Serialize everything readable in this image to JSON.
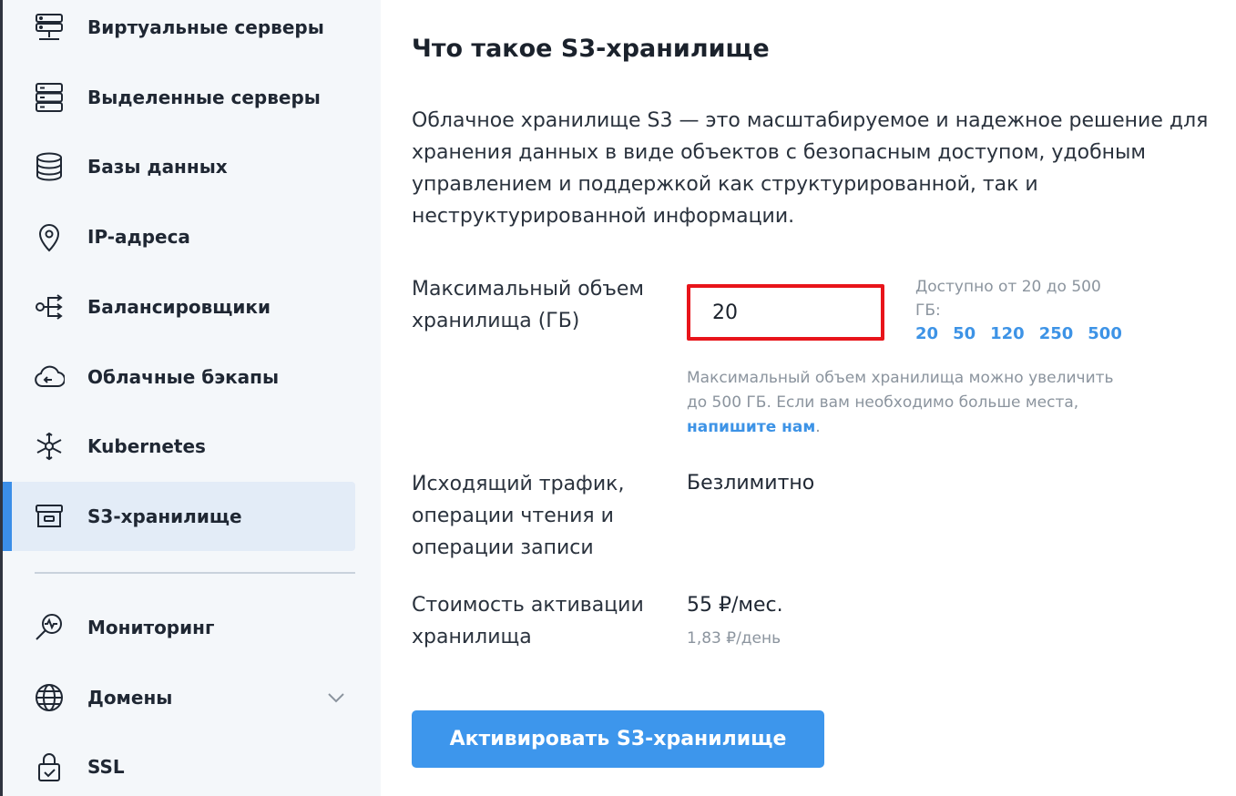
{
  "sidebar": {
    "items": [
      {
        "label": "Виртуальные серверы",
        "icon": "server-stack-icon"
      },
      {
        "label": "Выделенные серверы",
        "icon": "dedicated-server-icon"
      },
      {
        "label": "Базы данных",
        "icon": "database-icon"
      },
      {
        "label": "IP-адреса",
        "icon": "location-pin-icon"
      },
      {
        "label": "Балансировщики",
        "icon": "load-balancer-icon"
      },
      {
        "label": "Облачные бэкапы",
        "icon": "cloud-backup-icon"
      },
      {
        "label": "Kubernetes",
        "icon": "kubernetes-icon"
      },
      {
        "label": "S3-хранилище",
        "icon": "storage-box-icon",
        "active": true
      },
      {
        "label": "Мониторинг",
        "icon": "monitoring-icon"
      },
      {
        "label": "Домены",
        "icon": "globe-icon",
        "has_submenu": true
      },
      {
        "label": "SSL",
        "icon": "lock-check-icon"
      }
    ]
  },
  "main": {
    "title": "Что такое S3-хранилище",
    "description": "Облачное хранилище S3 — это масштабируемое и надежное решение для хранения данных в виде объектов с безопасным доступом, удобным управлением и поддержкой как структурированной, так и неструктурированной информации.",
    "max_size": {
      "label": "Максимальный объем хранилища (ГБ)",
      "value": "20",
      "range_hint": "Доступно от 20 до 500 ГБ:",
      "quick_options": [
        "20",
        "50",
        "120",
        "250",
        "500"
      ],
      "note": "Максимальный объем хранилища можно увеличить до 500 ГБ. Если вам необходимо больше места,",
      "note_link": "напишите нам",
      "note_end": "."
    },
    "traffic": {
      "label": "Исходящий трафик, операции чтения и операции записи",
      "value": "Безлимитно"
    },
    "cost": {
      "label": "Стоимость активации хранилища",
      "value": "55 ₽/мес.",
      "per_day": "1,83 ₽/день"
    },
    "activate_button": "Активировать S3-хранилище"
  },
  "colors": {
    "accent": "#3d96ec",
    "highlight_border": "#e8141a",
    "sidebar_bg": "#f4f7fa",
    "active_item_bg": "#e3ecf7"
  }
}
